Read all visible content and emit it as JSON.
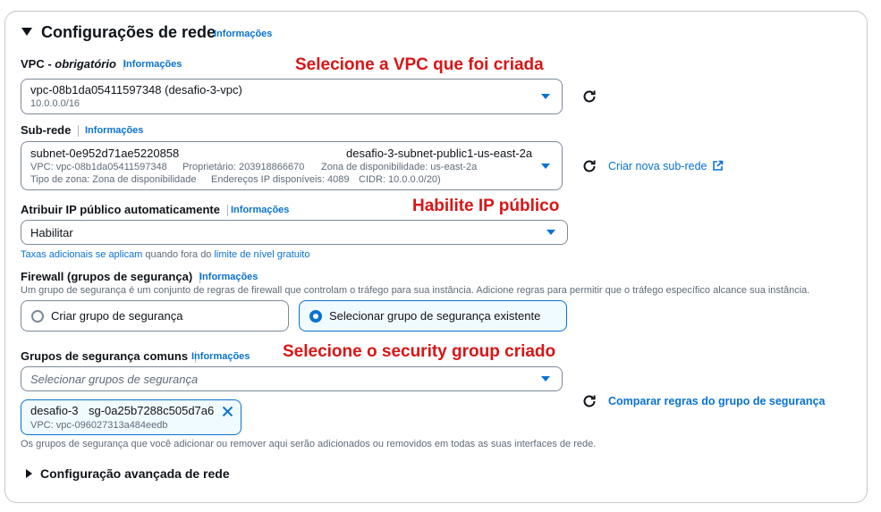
{
  "section": {
    "title": "Configurações de rede",
    "info": "Informações"
  },
  "vpc": {
    "label": "VPC - ",
    "required": "obrigatório",
    "info": "Informações",
    "value": "vpc-08b1da05411597348 (desafio-3-vpc)",
    "cidr": "10.0.0.0/16",
    "annotation": "Selecione a VPC que foi criada"
  },
  "subnet": {
    "label": "Sub-rede",
    "info": "Informações",
    "id": "subnet-0e952d71ae5220858",
    "name": "desafio-3-subnet-public1-us-east-2a",
    "line2": {
      "vpc": "VPC: vpc-08b1da05411597348",
      "owner": "Proprietário: 203918866670",
      "zone": "Zona de disponibilidade: us-east-2a"
    },
    "line3": {
      "zone_type": "Tipo de zona: Zona de disponibilidade",
      "ips": "Endereços IP disponíveis: 4089",
      "cidr": "CIDR: 10.0.0.0/20)"
    },
    "create_link": "Criar nova sub-rede"
  },
  "public_ip": {
    "label": "Atribuir IP público automaticamente",
    "info": "Informações",
    "value": "Habilitar",
    "annotation": "Habilite IP público",
    "note_link": "Taxas adicionais se aplicam",
    "note_text": " quando fora do ",
    "note_link2": "limite de nível gratuito"
  },
  "firewall": {
    "label": "Firewall (grupos de segurança)",
    "info": "Informações",
    "description": "Um grupo de segurança é um conjunto de regras de firewall que controlam o tráfego para sua instância. Adicione regras para permitir que o tráfego específico alcance sua instância.",
    "option_create": "Criar grupo de segurança",
    "option_select": "Selecionar grupo de segurança existente",
    "selected": "select"
  },
  "common_groups": {
    "label": "Grupos de segurança comuns",
    "info": "Informações",
    "placeholder": "Selecionar grupos de segurança",
    "annotation": "Selecione o security group criado",
    "token_name": "desafio-3",
    "token_id": "sg-0a25b7288c505d7a6",
    "token_vpc": "VPC: vpc-096027313a484eedb",
    "compare_link": "Comparar regras do grupo de segurança",
    "footer": "Os grupos de segurança que você adicionar ou remover aqui serão adicionados ou removidos em todas as suas interfaces de rede."
  },
  "advanced": {
    "label": "Configuração avançada de rede"
  },
  "colors": {
    "accent": "#0972d3",
    "annotation": "#d91515",
    "border": "#7d8998"
  },
  "icons": [
    "caret-down-icon",
    "refresh-icon",
    "external-link-icon",
    "close-icon",
    "expand-icon"
  ]
}
